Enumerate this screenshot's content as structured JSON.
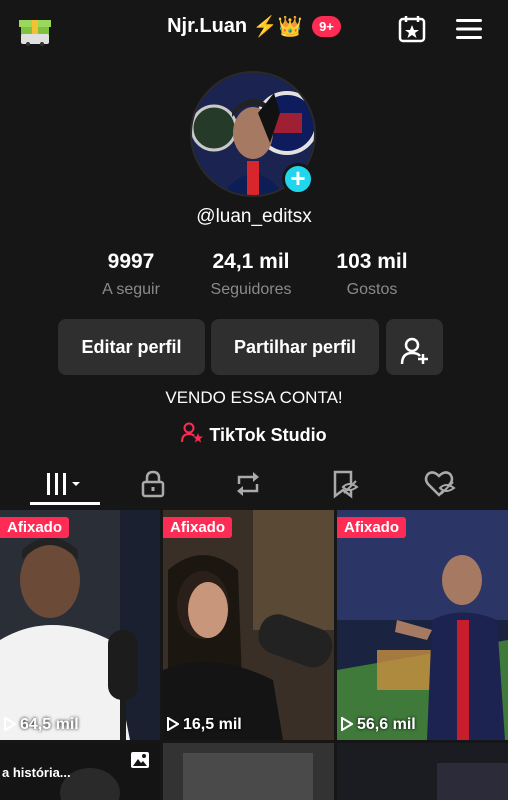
{
  "header": {
    "username": "Njr.Luan",
    "emoji": "⚡👑",
    "notifications": "9+"
  },
  "profile": {
    "handle": "@luan_editsx",
    "stats": [
      {
        "value": "9997",
        "label": "A seguir"
      },
      {
        "value": "24,1 mil",
        "label": "Seguidores"
      },
      {
        "value": "103 mil",
        "label": "Gostos"
      }
    ],
    "edit_label": "Editar perfil",
    "share_label": "Partilhar perfil",
    "bio": "VENDO ESSA CONTA!",
    "studio_label": "TikTok Studio"
  },
  "videos": [
    {
      "pinned": "Afixado",
      "views": "64,5 mil"
    },
    {
      "pinned": "Afixado",
      "views": "16,5 mil"
    },
    {
      "pinned": "Afixado",
      "views": "56,6 mil"
    }
  ],
  "second_row": {
    "caption": "a história..."
  },
  "colors": {
    "accent": "#fe2c55",
    "plus": "#20d5ec",
    "background": "#161616",
    "button": "#2f2f2f"
  }
}
